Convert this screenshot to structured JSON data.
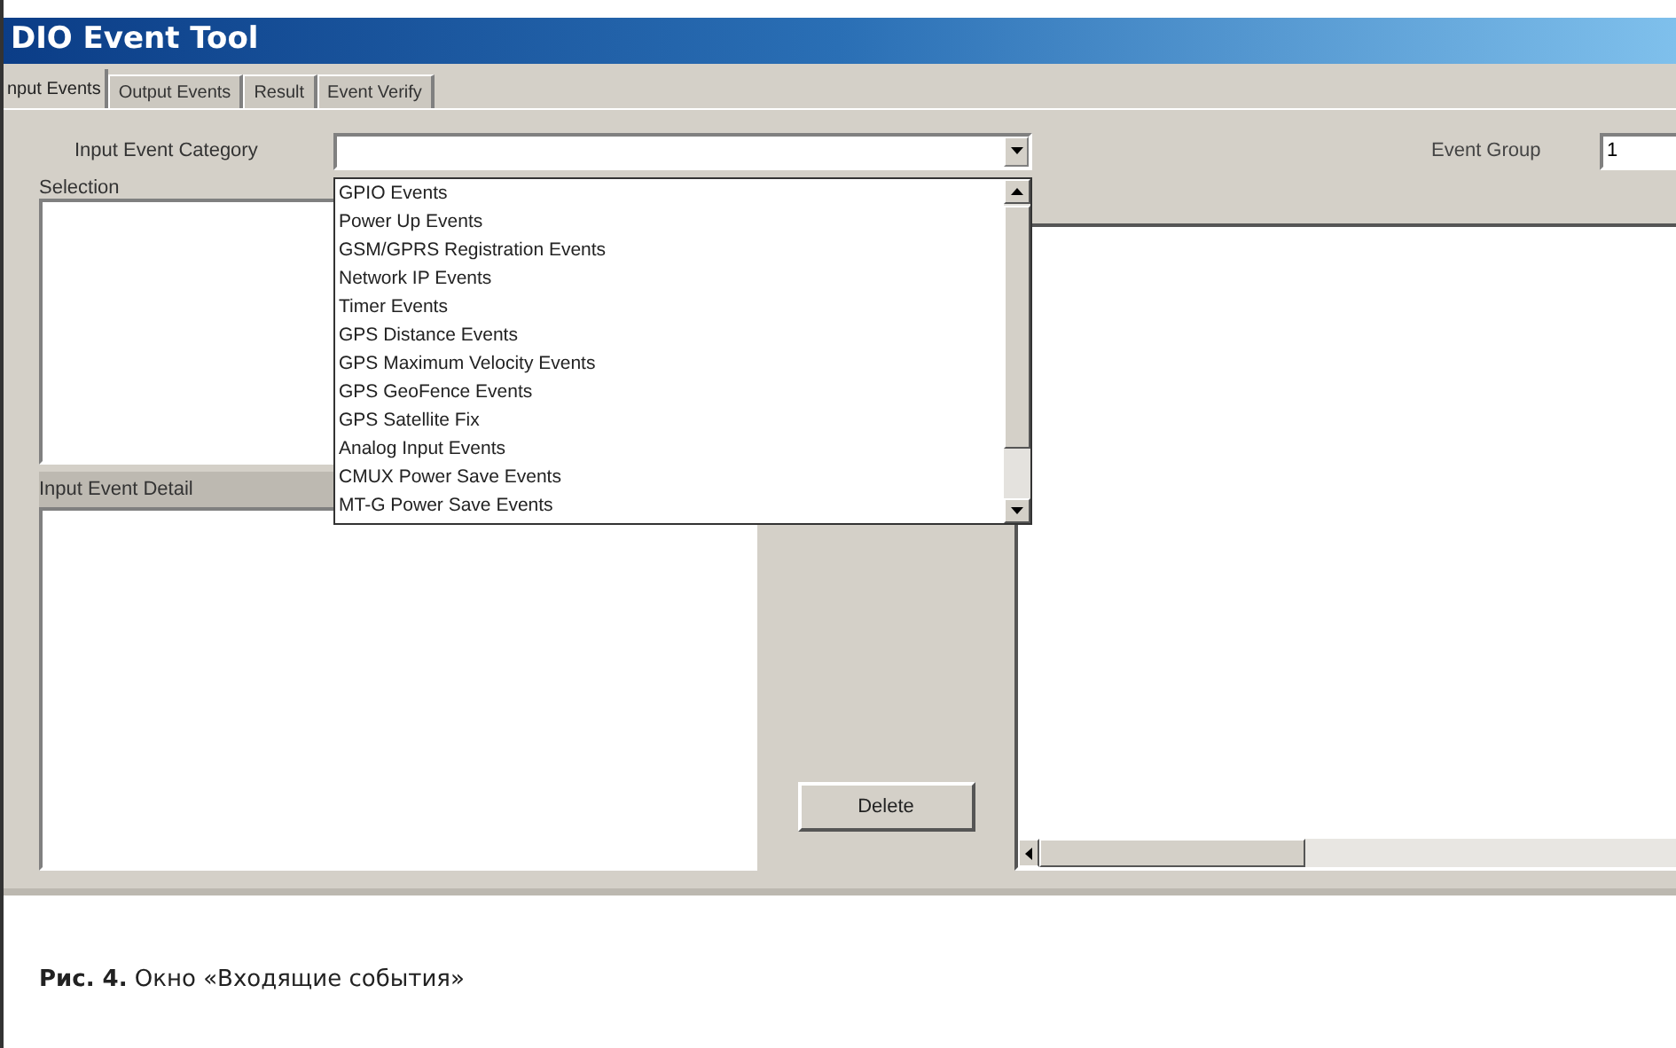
{
  "window": {
    "title": "DIO Event Tool"
  },
  "tabs": [
    {
      "label": "nput Events",
      "selected": true
    },
    {
      "label": "Output Events",
      "selected": false
    },
    {
      "label": "Result",
      "selected": false
    },
    {
      "label": "Event Verify",
      "selected": false
    }
  ],
  "input_event_category": {
    "label": "Input Event Category",
    "expanded": true,
    "options": [
      "GPIO Events",
      "Power Up Events",
      "GSM/GPRS Registration Events",
      "Network IP Events",
      "Timer Events",
      "GPS Distance Events",
      "GPS Maximum Velocity Events",
      "GPS GeoFence Events",
      "GPS Satellite Fix",
      "Analog Input Events",
      "CMUX Power Save Events",
      "MT-G Power Save Events"
    ]
  },
  "event_group": {
    "label": "Event Group",
    "value": "1"
  },
  "selection": {
    "label": "Selection"
  },
  "input_event_detail": {
    "label": "Input Event Detail"
  },
  "buttons": [
    "Delete"
  ],
  "caption": "**Рис. 4.** Окно «Входящие события»"
}
